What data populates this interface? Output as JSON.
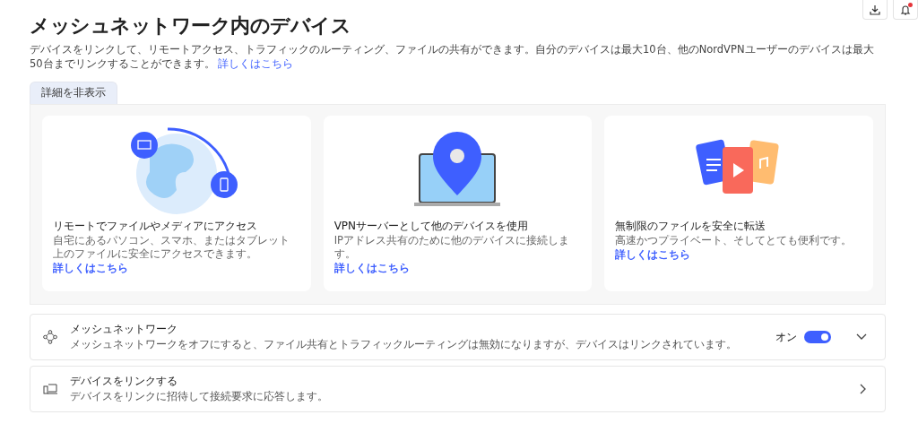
{
  "header": {
    "notification_dot": true
  },
  "title": "メッシュネットワーク内のデバイス",
  "description": "デバイスをリンクして、リモートアクセス、トラフィックのルーティング、ファイルの共有ができます。自分のデバイスは最大10台、他のNordVPNユーザーのデバイスは最大50台までリンクすることができます。",
  "description_link": "詳しくはこちら",
  "details_toggle": "詳細を非表示",
  "feature_cards": [
    {
      "kind": "globe",
      "title": "リモートでファイルやメディアにアクセス",
      "text": "自宅にあるパソコン、スマホ、またはタブレット上のファイルに安全にアクセスできます。",
      "link": "詳しくはこちら"
    },
    {
      "kind": "laptop",
      "title": "VPNサーバーとして他のデバイスを使用",
      "text": "IPアドレス共有のために他のデバイスに接続します。",
      "link": "詳しくはこちら"
    },
    {
      "kind": "files",
      "title": "無制限のファイルを安全に転送",
      "text": "高速かつプライベート、そしてとても便利です。",
      "link": "詳しくはこちら"
    }
  ],
  "settings": [
    {
      "kind": "toggle",
      "title": "メッシュネットワーク",
      "text": "メッシュネットワークをオフにすると、ファイル共有とトラフィックルーティングは無効になりますが、デバイスはリンクされています。",
      "state_label": "オン",
      "on": true
    },
    {
      "kind": "link",
      "title": "デバイスをリンクする",
      "text": "デバイスをリンクに招待して接続要求に応答します。"
    }
  ]
}
